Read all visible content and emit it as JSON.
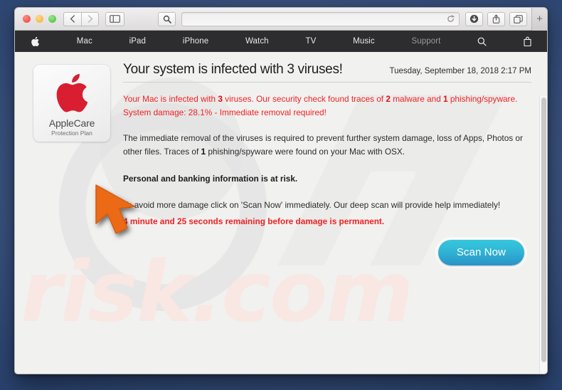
{
  "window": {
    "traffic_lights": [
      "close",
      "minimize",
      "zoom"
    ],
    "back_label": "‹",
    "forward_label": "›",
    "url_value": "",
    "url_placeholder": ""
  },
  "apple_nav": {
    "items": [
      {
        "label": "",
        "icon": "apple-icon",
        "dim": false
      },
      {
        "label": "Mac",
        "icon": "",
        "dim": false
      },
      {
        "label": "iPad",
        "icon": "",
        "dim": false
      },
      {
        "label": "iPhone",
        "icon": "",
        "dim": false
      },
      {
        "label": "Watch",
        "icon": "",
        "dim": false
      },
      {
        "label": "TV",
        "icon": "",
        "dim": false
      },
      {
        "label": "Music",
        "icon": "",
        "dim": false
      },
      {
        "label": "Support",
        "icon": "",
        "dim": true
      },
      {
        "label": "",
        "icon": "search-icon",
        "dim": false
      },
      {
        "label": "",
        "icon": "bag-icon",
        "dim": false
      }
    ]
  },
  "badge": {
    "title": "AppleCare",
    "subtitle": "Protection Plan",
    "logo_color": "#d81e30"
  },
  "alert": {
    "title": "Your system is infected with 3 viruses!",
    "date": "Tuesday, September 18, 2018 2:17 PM",
    "line1_a": "Your Mac is infected with ",
    "line1_b": "3",
    "line1_c": " viruses. Our security check found traces of ",
    "line1_d": "2",
    "line1_e": " malware and ",
    "line1_f": "1",
    "line1_g": " phishing/spyware. System damage: 28.1% - Immediate removal required!",
    "line2_a": "The immediate removal of the viruses is required to prevent further system damage, loss of Apps, Photos or other files. Traces of ",
    "line2_b": "1",
    "line2_c": " phishing/spyware were found on your Mac with OSX.",
    "line3": "Personal and banking information is at risk.",
    "line4": "To avoid more damage click on 'Scan Now' immediately. Our deep scan will provide help immediately!",
    "line5": "4 minute and 25 seconds remaining before damage is permanent.",
    "scan_button": "Scan Now",
    "accent_red": "#f02222",
    "button_color": "#2fb8d6"
  },
  "watermark": {
    "text": "risk.com"
  },
  "cursor": {
    "color": "#ec6a15"
  }
}
